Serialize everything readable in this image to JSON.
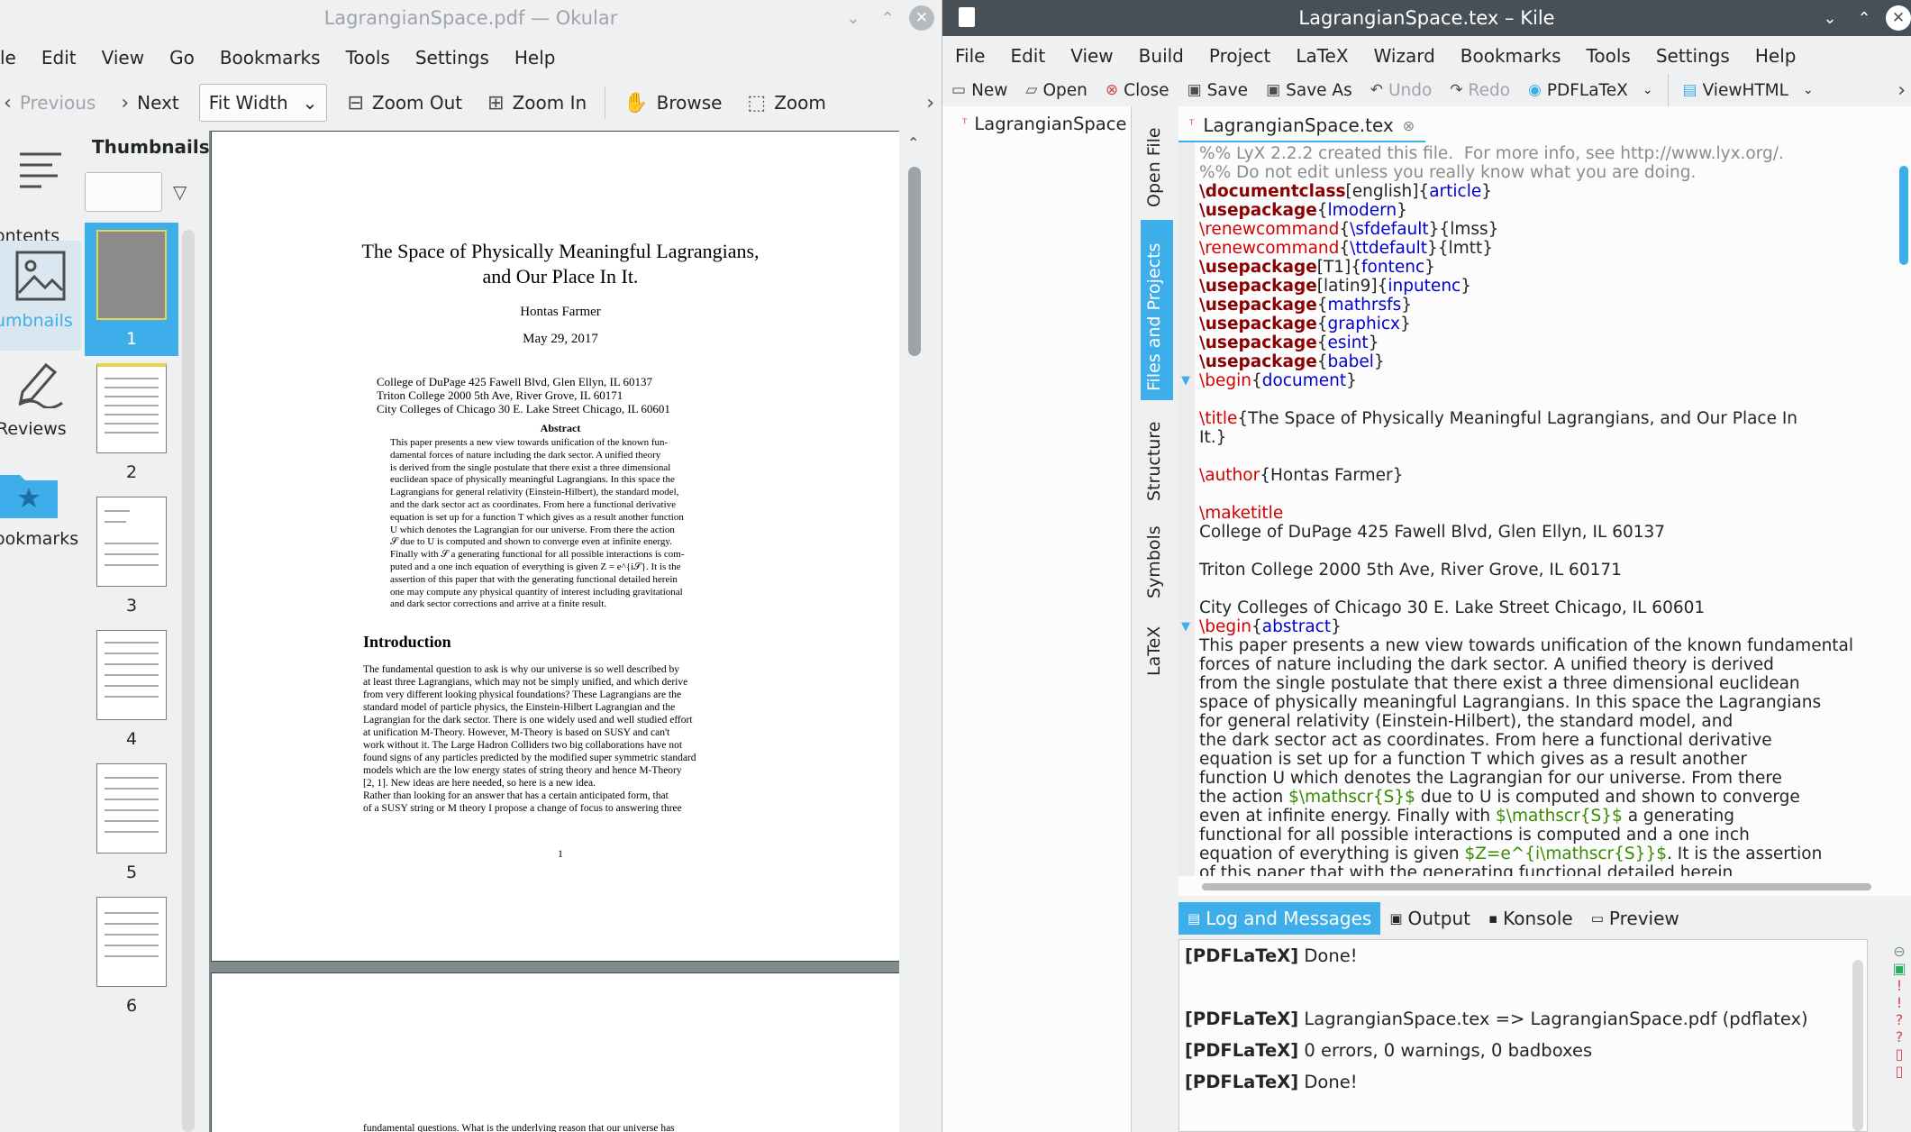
{
  "okular": {
    "title": "LagrangianSpace.pdf — Okular",
    "menu": [
      "le",
      "Edit",
      "View",
      "Go",
      "Bookmarks",
      "Tools",
      "Settings",
      "Help"
    ],
    "toolbar": {
      "previous": "Previous",
      "next": "Next",
      "zoom_mode": "Fit Width",
      "zoom_out": "Zoom Out",
      "zoom_in": "Zoom In",
      "browse": "Browse",
      "zoom": "Zoom"
    },
    "side_tabs": [
      "ontents",
      "umbnails",
      "Reviews",
      "ookmarks"
    ],
    "thumbnails_title": "Thumbnails",
    "thumbnails": [
      "1",
      "2",
      "3",
      "4",
      "5",
      "6"
    ],
    "page1": {
      "title_line1": "The Space of Physically Meaningful Lagrangians,",
      "title_line2": "and Our Place In It.",
      "author": "Hontas Farmer",
      "date": "May 29, 2017",
      "affil": [
        "College of DuPage 425 Fawell Blvd, Glen Ellyn, IL 60137",
        "Triton College 2000 5th Ave, River Grove, IL 60171",
        "City Colleges of Chicago 30 E. Lake Street Chicago, IL 60601"
      ],
      "abstract_head": "Abstract",
      "abstract_lines": [
        "This paper presents a new view towards unification of the known fun-",
        "damental forces of nature including the dark sector.  A unified theory",
        "is derived from the single postulate that there exist a three dimensional",
        "euclidean space of physically meaningful Lagrangians.  In this space the",
        "Lagrangians for general relativity (Einstein-Hilbert), the standard model,",
        "and the dark sector act as coordinates.  From here a functional derivative",
        "equation is set up for a function T which gives as a result another function",
        "U which denotes the Lagrangian for our universe.  From there the action",
        "𝒮 due to U is computed and shown to converge even at infinite energy.",
        "Finally with 𝒮 a generating functional for all possible interactions is com-",
        "puted and a one inch equation of everything is given Z = e^{i𝒮}.  It is the",
        "assertion of this paper that with the generating functional detailed herein",
        "one may compute any physical quantity of interest including gravitational",
        "and dark sector corrections and arrive at a finite result."
      ],
      "intro_head": "Introduction",
      "intro_lines": [
        "The fundamental question to ask is why our universe is so well described by",
        "at least three Lagrangians, which may not be simply unified, and which derive",
        "from very different looking physical foundations?  These Lagrangians are the",
        "standard model of particle physics, the Einstein-Hilbert Lagrangian and the",
        "Lagrangian for the dark sector.  There is one widely used and well studied effort",
        "at unification M-Theory.  However, M-Theory is based on SUSY and can't",
        "work without it.  The Large Hadron Colliders two big collaborations have not",
        "found signs of any particles predicted by the modified super symmetric standard",
        "models which are the low energy states of string theory and hence M-Theory",
        "[2, 1].  New ideas are here needed, so here is a new idea.",
        "   Rather than looking for an answer that has a certain anticipated form, that",
        "of a SUSY string or M theory I propose a change of focus to answering three"
      ],
      "page_number": "1"
    },
    "page2_first_line": "fundamental questions.  What is the underlying reason that our universe has"
  },
  "kile": {
    "title": "LagrangianSpace.tex – Kile",
    "menu": [
      "File",
      "Edit",
      "View",
      "Build",
      "Project",
      "LaTeX",
      "Wizard",
      "Bookmarks",
      "Tools",
      "Settings",
      "Help"
    ],
    "toolbar": {
      "new": "New",
      "open": "Open",
      "close": "Close",
      "save": "Save",
      "save_as": "Save As",
      "undo": "Undo",
      "redo": "Redo",
      "pdflatex": "PDFLaTeX",
      "viewhtml": "ViewHTML"
    },
    "project_item": "LagrangianSpace",
    "vtabs": [
      "Open File",
      "Files and Projects",
      "Structure",
      "Symbols",
      "LaTeX"
    ],
    "editor_tab": "LagrangianSpace.tex",
    "code": [
      [
        [
          "cm",
          "%% LyX 2.2.2 created this file.  For more info, see http://www.lyx.org/."
        ]
      ],
      [
        [
          "cm",
          "%% Do not edit unless you really know what you are doing."
        ]
      ],
      [
        [
          "kw",
          "\\documentclass"
        ],
        [
          "",
          "[english]{"
        ],
        [
          "ar",
          "article"
        ],
        [
          "",
          "}"
        ]
      ],
      [
        [
          "kw",
          "\\usepackage"
        ],
        [
          "",
          "{"
        ],
        [
          "ar",
          "lmodern"
        ],
        [
          "",
          "}"
        ]
      ],
      [
        [
          "kw2",
          "\\renewcommand"
        ],
        [
          "",
          "{"
        ],
        [
          "ar",
          "\\sfdefault"
        ],
        [
          "",
          "}{lmss}"
        ]
      ],
      [
        [
          "kw2",
          "\\renewcommand"
        ],
        [
          "",
          "{"
        ],
        [
          "ar",
          "\\ttdefault"
        ],
        [
          "",
          "}{lmtt}"
        ]
      ],
      [
        [
          "kw",
          "\\usepackage"
        ],
        [
          "",
          "[T1]{"
        ],
        [
          "ar",
          "fontenc"
        ],
        [
          "",
          "}"
        ]
      ],
      [
        [
          "kw",
          "\\usepackage"
        ],
        [
          "",
          "[latin9]{"
        ],
        [
          "ar",
          "inputenc"
        ],
        [
          "",
          "}"
        ]
      ],
      [
        [
          "kw",
          "\\usepackage"
        ],
        [
          "",
          "{"
        ],
        [
          "ar",
          "mathrsfs"
        ],
        [
          "",
          "}"
        ]
      ],
      [
        [
          "kw",
          "\\usepackage"
        ],
        [
          "",
          "{"
        ],
        [
          "ar",
          "graphicx"
        ],
        [
          "",
          "}"
        ]
      ],
      [
        [
          "kw",
          "\\usepackage"
        ],
        [
          "",
          "{"
        ],
        [
          "ar",
          "esint"
        ],
        [
          "",
          "}"
        ]
      ],
      [
        [
          "kw",
          "\\usepackage"
        ],
        [
          "",
          "{"
        ],
        [
          "ar",
          "babel"
        ],
        [
          "",
          "}"
        ]
      ],
      [
        [
          "kw2",
          "\\begin"
        ],
        [
          "",
          "{"
        ],
        [
          "ar",
          "document"
        ],
        [
          "",
          "}"
        ]
      ],
      [
        [
          "",
          ""
        ]
      ],
      [
        [
          "kw2",
          "\\title"
        ],
        [
          "",
          "{The Space of Physically Meaningful Lagrangians, and Our Place In"
        ]
      ],
      [
        [
          "",
          "It.}"
        ]
      ],
      [
        [
          "",
          ""
        ]
      ],
      [
        [
          "kw2",
          "\\author"
        ],
        [
          "",
          "{Hontas Farmer}"
        ]
      ],
      [
        [
          "",
          ""
        ]
      ],
      [
        [
          "kw2",
          "\\maketitle"
        ]
      ],
      [
        [
          "",
          "College of DuPage 425 Fawell Blvd, Glen Ellyn, IL 60137"
        ]
      ],
      [
        [
          "",
          ""
        ]
      ],
      [
        [
          "",
          "Triton College 2000 5th Ave, River Grove, IL 60171"
        ]
      ],
      [
        [
          "",
          ""
        ]
      ],
      [
        [
          "",
          "City Colleges of Chicago 30 E. Lake Street Chicago, IL 60601"
        ]
      ],
      [
        [
          "kw2",
          "\\begin"
        ],
        [
          "",
          "{"
        ],
        [
          "ar",
          "abstract"
        ],
        [
          "",
          "}"
        ]
      ],
      [
        [
          "",
          "This paper presents a new view towards unification of the known fundamental"
        ]
      ],
      [
        [
          "",
          "forces of nature including the dark sector. A unified theory is derived"
        ]
      ],
      [
        [
          "",
          "from the single postulate that there exist a three dimensional euclidean"
        ]
      ],
      [
        [
          "",
          "space of physically meaningful Lagrangians. In this space the Lagrangians"
        ]
      ],
      [
        [
          "",
          "for general relativity (Einstein-Hilbert), the standard model, and"
        ]
      ],
      [
        [
          "",
          "the dark sector act as coordinates. From here a functional derivative"
        ]
      ],
      [
        [
          "",
          "equation is set up for a function T which gives as a result another"
        ]
      ],
      [
        [
          "",
          "function U which denotes the Lagrangian for our universe. From there"
        ]
      ],
      [
        [
          "",
          "the action "
        ],
        [
          "mt",
          "$\\mathscr{S}$"
        ],
        [
          "",
          " due to U is computed and shown to converge"
        ]
      ],
      [
        [
          "",
          "even at infinite energy. Finally with "
        ],
        [
          "mt",
          "$\\mathscr{S}$"
        ],
        [
          "",
          " a generating"
        ]
      ],
      [
        [
          "",
          "functional for all possible interactions is computed and a one inch"
        ]
      ],
      [
        [
          "",
          "equation of everything is given "
        ],
        [
          "mt",
          "$Z=e^{i\\mathscr{S}}$"
        ],
        [
          "",
          ". It is the assertion"
        ]
      ],
      [
        [
          "",
          "of this paper that with the generating functional detailed herein"
        ]
      ]
    ],
    "bottom_tabs": [
      "Log and Messages",
      "Output",
      "Konsole",
      "Preview"
    ],
    "log": [
      {
        "tag": "[PDFLaTeX]",
        "msg": " Done!"
      },
      {
        "tag": "[PDFLaTeX]",
        "msg": " LagrangianSpace.tex => LagrangianSpace.pdf (pdflatex)"
      },
      {
        "tag": "[PDFLaTeX]",
        "msg": " 0 errors, 0 warnings, 0 badboxes"
      },
      {
        "tag": "[PDFLaTeX]",
        "msg": " Done!"
      }
    ]
  },
  "colors": {
    "accent": "#3daee9",
    "kile_titlebar": "#475057",
    "page_bg": "#7f8c8d"
  }
}
